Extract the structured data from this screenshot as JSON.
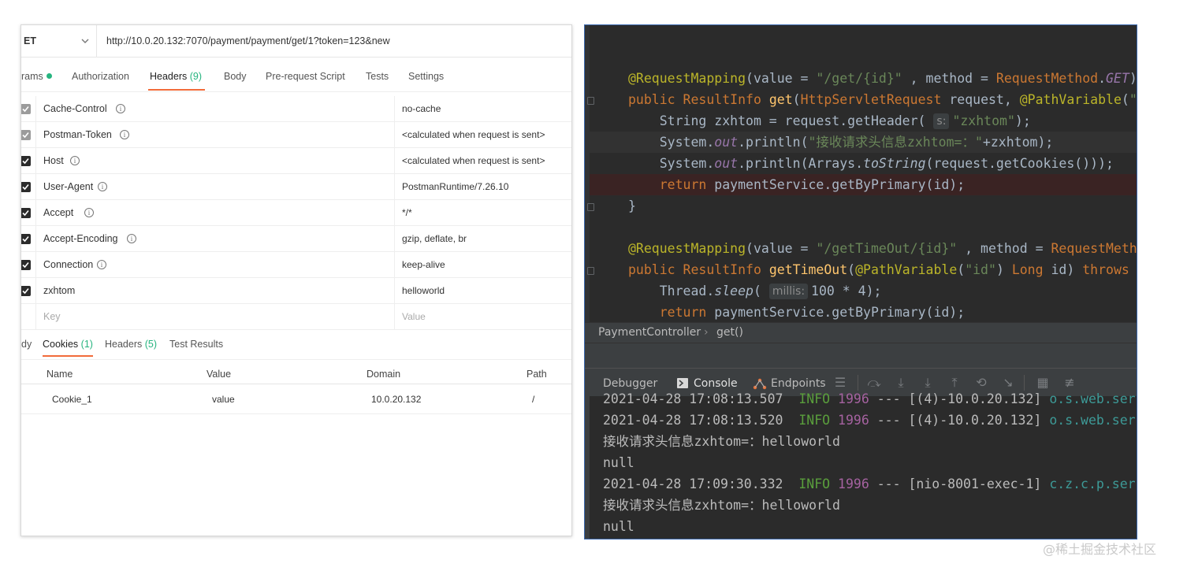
{
  "postman": {
    "method": "ET",
    "url": "http://10.0.20.132:7070/payment/payment/get/1?token=123&new",
    "tabs": {
      "params": "rams",
      "authorization": "Authorization",
      "headers": "Headers",
      "headers_count": "(9)",
      "body": "Body",
      "prerequest": "Pre-request Script",
      "tests": "Tests",
      "settings": "Settings"
    },
    "headers": [
      {
        "key": "Cache-Control",
        "value": "no-cache",
        "checked": "grey"
      },
      {
        "key": "Postman-Token",
        "value": "<calculated when request is sent>",
        "checked": "grey"
      },
      {
        "key": "Host",
        "value": "<calculated when request is sent>",
        "checked": "on"
      },
      {
        "key": "User-Agent",
        "value": "PostmanRuntime/7.26.10",
        "checked": "on"
      },
      {
        "key": "Accept",
        "value": "*/*",
        "checked": "on"
      },
      {
        "key": "Accept-Encoding",
        "value": "gzip, deflate, br",
        "checked": "on"
      },
      {
        "key": "Connection",
        "value": "keep-alive",
        "checked": "on"
      },
      {
        "key": "zxhtom",
        "value": "helloworld",
        "checked": "on"
      }
    ],
    "new_key_placeholder": "Key",
    "new_value_placeholder": "Value",
    "resp_tabs": {
      "body": "dy",
      "cookies": "Cookies",
      "cookies_count": "(1)",
      "headers": "Headers",
      "headers_count": "(5)",
      "test_results": "Test Results"
    },
    "cookie_columns": [
      "Name",
      "Value",
      "Domain",
      "Path"
    ],
    "cookies": [
      {
        "name": "Cookie_1",
        "value": "value",
        "domain": "10.0.20.132",
        "path": "/"
      }
    ]
  },
  "ide": {
    "breadcrumb": [
      "PaymentController",
      "get()"
    ],
    "debug_tabs": {
      "debugger": "Debugger",
      "console": "Console",
      "endpoints": "Endpoints"
    },
    "console_lines": [
      {
        "time": "2021-04-28 17:08:13.507",
        "level": "INFO",
        "pid": "1996",
        "sep": "---",
        "thread": "[(4)-10.0.20.132]",
        "logger": "o.s.web.ser"
      },
      {
        "time": "2021-04-28 17:08:13.520",
        "level": "INFO",
        "pid": "1996",
        "sep": "---",
        "thread": "[(4)-10.0.20.132]",
        "logger": "o.s.web.ser"
      },
      {
        "text": "接收请求头信息zxhtom=：helloworld"
      },
      {
        "text": "null"
      },
      {
        "time": "2021-04-28 17:09:30.332",
        "level": "INFO",
        "pid": "1996",
        "sep": "---",
        "thread": "[nio-8001-exec-1]",
        "logger": "c.z.c.p.ser"
      },
      {
        "text": "接收请求头信息zxhtom=：helloworld"
      },
      {
        "text": "null"
      }
    ]
  },
  "watermark": "@稀土掘金技术社区"
}
